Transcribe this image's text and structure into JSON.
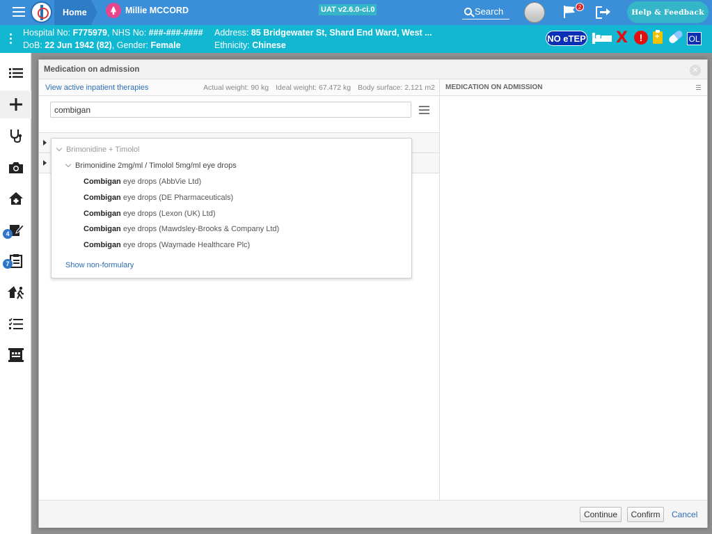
{
  "topbar": {
    "home_label": "Home",
    "patient_name": "Millie MCCORD",
    "version": "UAT v2.6.0-ci.0",
    "search_label": "Search",
    "flag_count": "2",
    "help_label": "Help & Feedback"
  },
  "banner": {
    "line1_prefix": "Hospital No: ",
    "hospital_no": "F775979",
    "line1_mid": ", NHS No: ",
    "nhs_no": "###-###-####",
    "address_label": "Address: ",
    "address": "85 Bridgewater St, Shard End Ward, West ...",
    "dob_label": "DoB: ",
    "dob": "22 Jun 1942 (82)",
    "gender_label": ", Gender: ",
    "gender": "Female",
    "ethnicity_label": "Ethnicity: ",
    "ethnicity": "Chinese",
    "no_etep": "NO eTEP",
    "x_mark": "X",
    "alert_mark": "!",
    "ol_label": "OL"
  },
  "sidebar": {
    "badges": [
      "4",
      "7"
    ]
  },
  "modal": {
    "title": "Medication on admission",
    "close": "✕",
    "view_link": "View active inpatient therapies",
    "actual_weight": "Actual weight: 90 kg",
    "ideal_weight": "Ideal weight: 67.472 kg",
    "body_surface": "Body surface: 2.121 m2",
    "right_title": "MEDICATION ON ADMISSION",
    "search_value": "combigan",
    "dropdown": {
      "group": "Brimonidine + Timolol",
      "vtm": "Brimonidine 2mg/ml / Timolol 5mg/ml eye drops",
      "products": [
        {
          "bold": "Combigan",
          "rest": " eye drops (AbbVie Ltd)"
        },
        {
          "bold": "Combigan",
          "rest": " eye drops (DE Pharmaceuticals)"
        },
        {
          "bold": "Combigan",
          "rest": " eye drops (Lexon (UK) Ltd)"
        },
        {
          "bold": "Combigan",
          "rest": " eye drops (Mawdsley-Brooks & Company Ltd)"
        },
        {
          "bold": "Combigan",
          "rest": " eye drops (Waymade Healthcare Plc)"
        }
      ],
      "show_non_formulary": "Show non-formulary"
    },
    "footer": {
      "continue": "Continue",
      "confirm": "Confirm",
      "cancel": "Cancel"
    }
  },
  "colors": {
    "topbar": "#3a8fd8",
    "banner": "#12b8d2",
    "help_button": "#35b6c8",
    "etep_badge": "#0b2fb5",
    "alert_red": "#e01010",
    "link_blue": "#2b6db5"
  },
  "icons": [
    "hamburger-icon",
    "logo-icon",
    "female-icon",
    "search-icon",
    "flag-icon",
    "logout-icon",
    "bed-icon",
    "x-icon",
    "alert-icon",
    "clipboard-icon",
    "pill-icon",
    "list-icon",
    "plus-icon",
    "stethoscope-icon",
    "camera-icon",
    "house-icon",
    "edit-doc-icon",
    "clipboard-edit-icon",
    "house-run-icon",
    "checklist-icon",
    "building-icon",
    "close-icon"
  ]
}
